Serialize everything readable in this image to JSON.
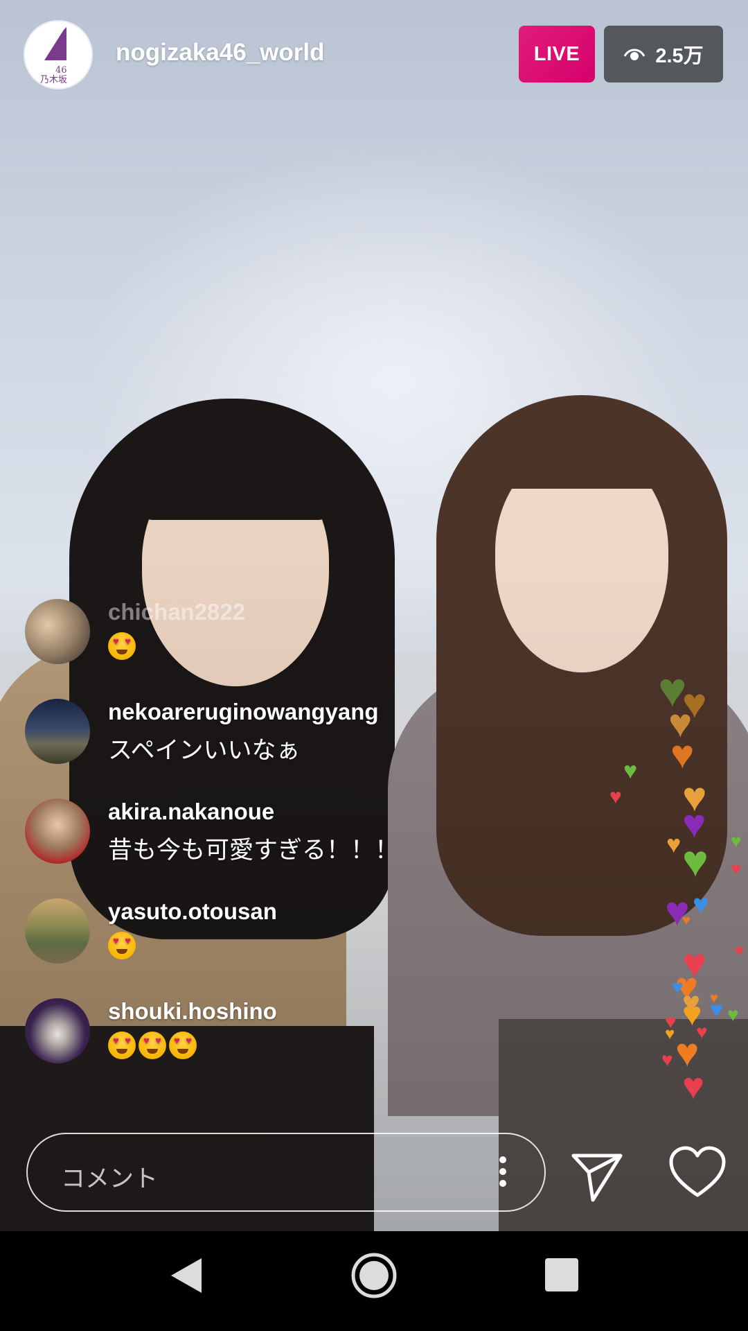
{
  "header": {
    "host_username": "nogizaka46_world",
    "host_avatar_text": "乃木坂",
    "host_avatar_number": "46",
    "live_label": "LIVE",
    "viewer_count": "2.5万",
    "viewer_icon": "eye-icon"
  },
  "comments": [
    {
      "username": "chichan2822",
      "text": "",
      "emojis": [
        "heart-eyes"
      ],
      "faded": true
    },
    {
      "username": "nekoareruginowangyang",
      "text": "スペインいいなぁ",
      "emojis": []
    },
    {
      "username": "akira.nakanoue",
      "text": "昔も今も可愛すぎる！！！",
      "emojis": []
    },
    {
      "username": "yasuto.otousan",
      "text": "",
      "emojis": [
        "heart-eyes"
      ]
    },
    {
      "username": "shouki.hoshino",
      "text": "",
      "emojis": [
        "heart-eyes",
        "heart-eyes",
        "heart-eyes"
      ]
    }
  ],
  "comment_bar": {
    "placeholder": "コメント",
    "more_icon": "more-vertical-icon",
    "send_icon": "send-icon",
    "like_icon": "heart-outline-icon"
  },
  "nav": {
    "back_icon": "back-triangle-icon",
    "home_icon": "home-circle-icon",
    "recent_icon": "recents-square-icon"
  },
  "colors": {
    "live_badge": "#d6006a",
    "viewer_badge": "#46484b",
    "heart_palette": [
      "#6dbb3f",
      "#f3a21f",
      "#e8a13a",
      "#8a2bb7",
      "#e8404e",
      "#3b8ee5",
      "#f07c22"
    ]
  }
}
